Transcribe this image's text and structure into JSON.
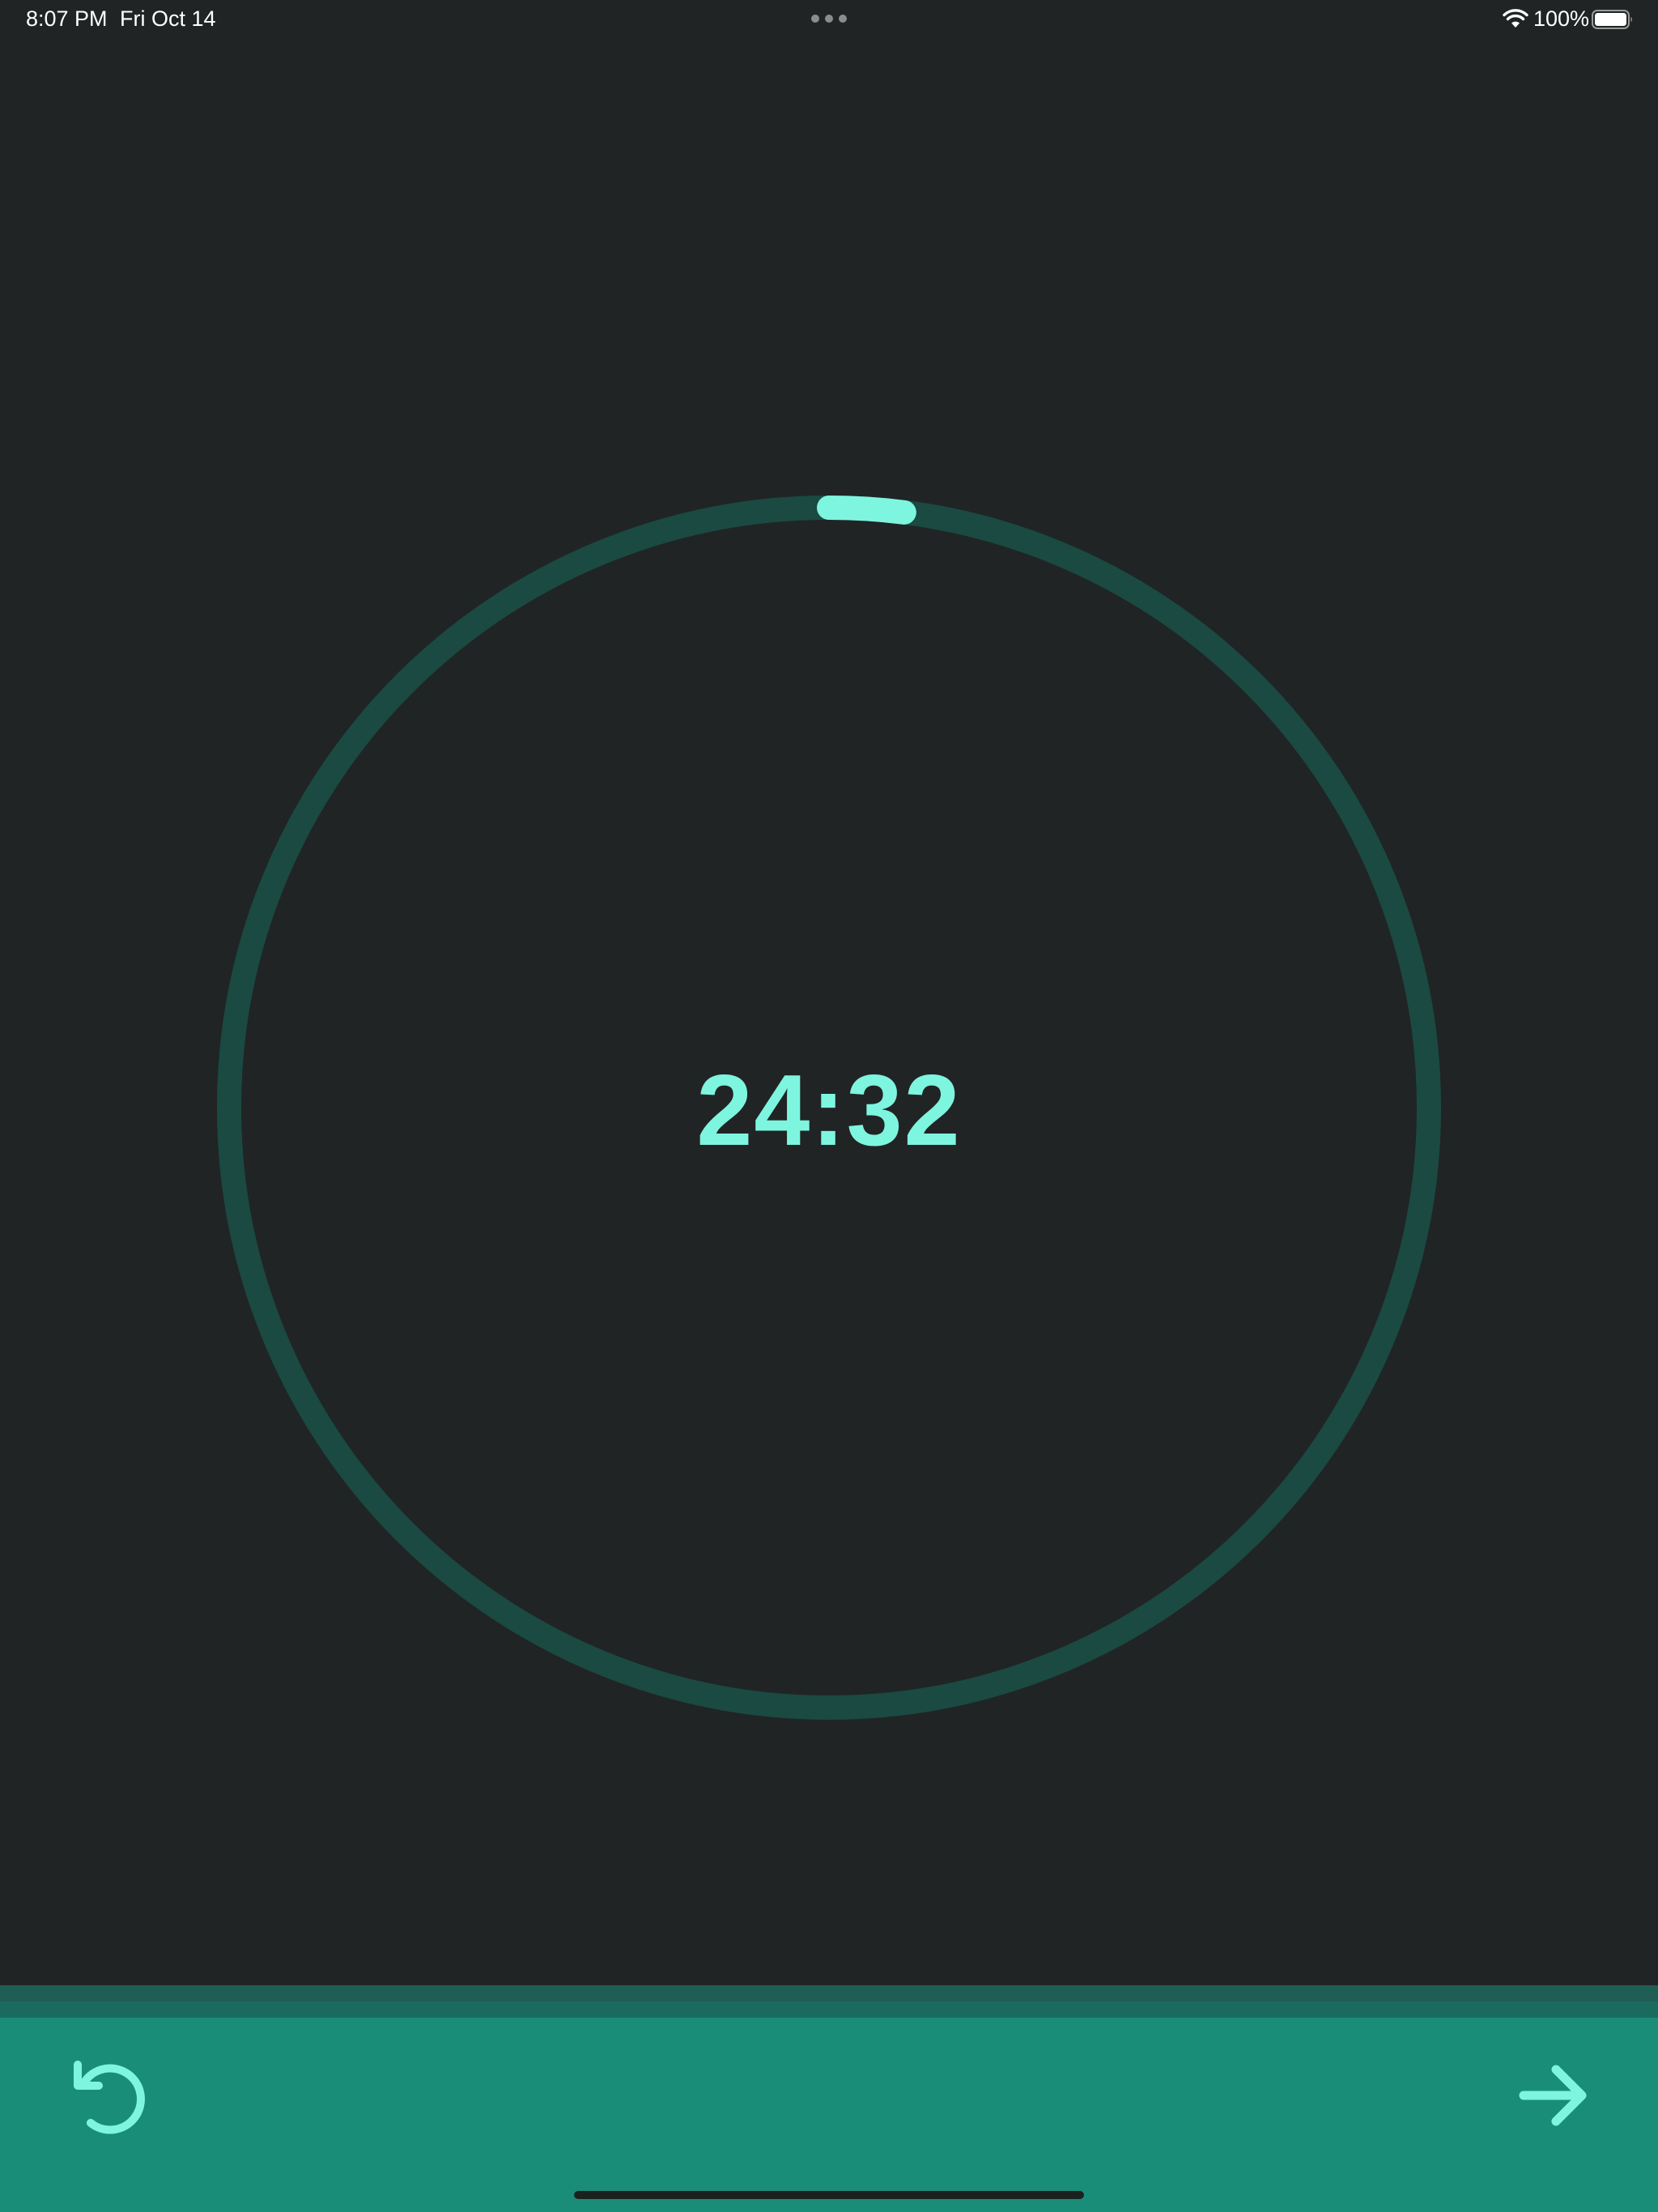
{
  "status_bar": {
    "time": "8:07 PM",
    "date": "Fri Oct 14",
    "battery_percent": "100%",
    "icons": [
      "multitask-dots-icon",
      "wifi-icon",
      "battery-icon"
    ]
  },
  "timer": {
    "display": "24:32",
    "progress_fraction": 0.02
  },
  "bottom_bar": {
    "icons": [
      "reset-icon",
      "arrow-right-icon"
    ]
  },
  "colors": {
    "background": "#212424",
    "accent": "#7ef5df",
    "ring_track": "#1a4a42",
    "bottom_bar": "#1a8d78"
  }
}
